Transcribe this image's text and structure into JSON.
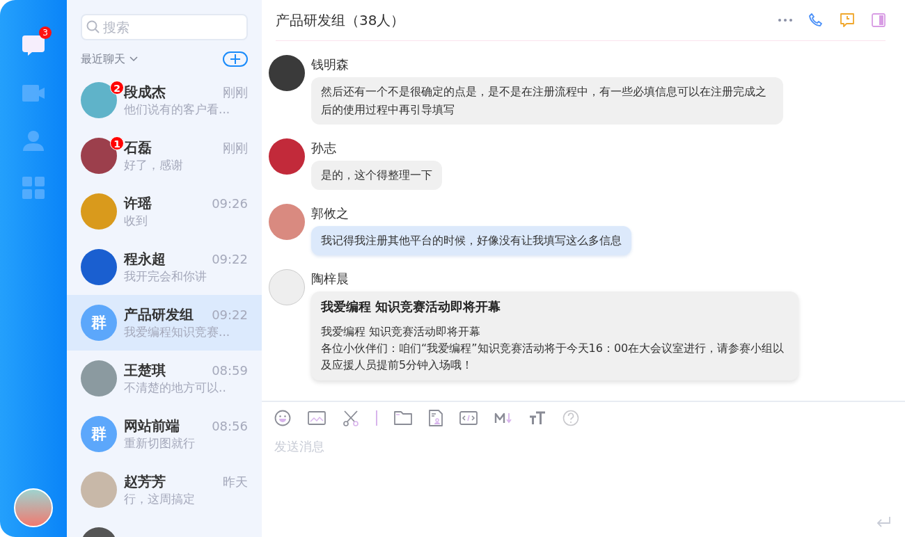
{
  "nav": {
    "items": [
      {
        "kind": "chat",
        "selected": true,
        "badge": "3"
      },
      {
        "kind": "video",
        "selected": false
      },
      {
        "kind": "contacts",
        "selected": false
      },
      {
        "kind": "apps",
        "selected": false
      }
    ]
  },
  "chat_list": {
    "search": {
      "placeholder": "搜索"
    },
    "section_title": "最近聊天",
    "items": [
      {
        "name": "段成杰",
        "time": "刚刚",
        "preview": "他们说有的客户看...",
        "unread": "2",
        "selected": false
      },
      {
        "name": "石磊",
        "time": "刚刚",
        "preview": "好了，感谢",
        "unread": "1",
        "selected": false
      },
      {
        "name": "许瑶",
        "time": "09:26",
        "preview": "收到",
        "selected": false
      },
      {
        "name": "程永超",
        "time": "09:22",
        "preview": "我开完会和你讲",
        "selected": false
      },
      {
        "name": "产品研发组",
        "time": "09:22",
        "preview": "我爱编程知识竞赛...",
        "avatar_text": "群",
        "selected": true
      },
      {
        "name": "王楚琪",
        "time": "08:59",
        "preview": "不清楚的地方可以..",
        "selected": false
      },
      {
        "name": "网站前端",
        "time": "08:56",
        "preview": "重新切图就行",
        "avatar_text": "群",
        "selected": false
      },
      {
        "name": "赵芳芳",
        "time": "昨天",
        "preview": "行，这周搞定",
        "selected": false
      },
      {
        "selected": false
      }
    ]
  },
  "chat": {
    "title": "产品研发组（38人）",
    "messages": [
      {
        "sender": "钱明森",
        "kind": "text",
        "highlighted": false,
        "text": "然后还有一个不是很确定的点是，是不是在注册流程中，有一些必填信息可以在注册完成之后的使用过程中再引导填写"
      },
      {
        "sender": "孙志",
        "kind": "text",
        "highlighted": false,
        "text": "是的，这个得整理一下"
      },
      {
        "sender": "郭攸之",
        "kind": "text",
        "highlighted": true,
        "text": "我记得我注册其他平台的时候，好像没有让我填写这么多信息"
      },
      {
        "sender": "陶梓晨",
        "kind": "card",
        "title": "我爱编程 知识竞赛活动即将开幕",
        "lines": [
          "我爱编程 知识竞赛活动即将开幕",
          "各位小伙伴们：咱们“我爱编程”知识竞赛活动将于今天16：00在大会议室进行，请参赛小组以及应援人员提前5分钟入场哦！"
        ]
      }
    ],
    "composer": {
      "placeholder": "发送消息"
    }
  }
}
